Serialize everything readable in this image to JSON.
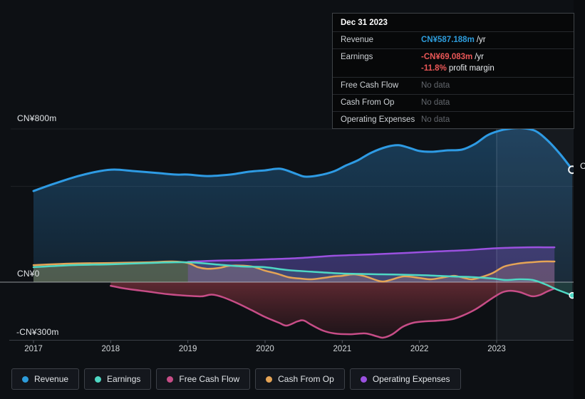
{
  "y_axis": {
    "top_label": "CN¥800m",
    "zero_label": "CN¥0",
    "bottom_label": "-CN¥300m"
  },
  "x_axis": {
    "years": [
      "2017",
      "2018",
      "2019",
      "2020",
      "2021",
      "2022",
      "2023"
    ]
  },
  "edge_label": "C",
  "tooltip": {
    "date": "Dec 31 2023",
    "rows": [
      {
        "label": "Revenue",
        "value": "CN¥587.188m",
        "suffix": "/yr"
      },
      {
        "label": "Earnings",
        "value": "-CN¥69.083m",
        "suffix": "/yr",
        "extra_value": "-11.8%",
        "extra_suffix": "profit margin"
      },
      {
        "label": "Free Cash Flow",
        "value": "No data"
      },
      {
        "label": "Cash From Op",
        "value": "No data"
      },
      {
        "label": "Operating Expenses",
        "value": "No data"
      }
    ]
  },
  "legend": [
    {
      "label": "Revenue",
      "color": "#2d9cdb"
    },
    {
      "label": "Earnings",
      "color": "#4fd8c4"
    },
    {
      "label": "Free Cash Flow",
      "color": "#c74d87"
    },
    {
      "label": "Cash From Op",
      "color": "#e5a456"
    },
    {
      "label": "Operating Expenses",
      "color": "#9b51e0"
    }
  ],
  "chart_data": {
    "type": "line",
    "title": "Earnings and Revenue History",
    "unit": "CN¥ millions",
    "x_range": [
      2017,
      2024
    ],
    "x_ticks": [
      2017,
      2018,
      2019,
      2020,
      2021,
      2022,
      2023
    ],
    "y_gridlines_labeled": [
      800,
      0,
      -300
    ],
    "highlight_from_x": 2023,
    "legend_position": "bottom",
    "series": [
      {
        "name": "Revenue",
        "color": "#2e9be4",
        "end_marker": "open-circle",
        "last_value_label": "CN¥587.188m /yr",
        "points": [
          [
            2017.0,
            476
          ],
          [
            2017.26,
            513
          ],
          [
            2017.58,
            554
          ],
          [
            2017.86,
            580
          ],
          [
            2018.05,
            588
          ],
          [
            2018.3,
            580
          ],
          [
            2018.6,
            570
          ],
          [
            2018.85,
            562
          ],
          [
            2019.0,
            562
          ],
          [
            2019.25,
            554
          ],
          [
            2019.55,
            562
          ],
          [
            2019.8,
            577
          ],
          [
            2020.0,
            584
          ],
          [
            2020.2,
            592
          ],
          [
            2020.4,
            566
          ],
          [
            2020.52,
            551
          ],
          [
            2020.7,
            558
          ],
          [
            2020.9,
            580
          ],
          [
            2021.05,
            610
          ],
          [
            2021.2,
            636
          ],
          [
            2021.38,
            677
          ],
          [
            2021.58,
            707
          ],
          [
            2021.73,
            715
          ],
          [
            2021.88,
            700
          ],
          [
            2022.0,
            685
          ],
          [
            2022.17,
            681
          ],
          [
            2022.35,
            688
          ],
          [
            2022.55,
            692
          ],
          [
            2022.72,
            722
          ],
          [
            2022.88,
            767
          ],
          [
            2023.03,
            790
          ],
          [
            2023.18,
            802
          ],
          [
            2023.33,
            805
          ],
          [
            2023.5,
            790
          ],
          [
            2023.65,
            744
          ],
          [
            2023.82,
            670
          ],
          [
            2023.98,
            587.188
          ]
        ]
      },
      {
        "name": "Free Cash Flow",
        "color": "#c74d87",
        "points": [
          [
            2018.0,
            -19
          ],
          [
            2018.18,
            -33
          ],
          [
            2018.46,
            -48
          ],
          [
            2018.74,
            -63
          ],
          [
            2019.0,
            -71
          ],
          [
            2019.18,
            -74
          ],
          [
            2019.31,
            -65
          ],
          [
            2019.45,
            -78
          ],
          [
            2019.63,
            -108
          ],
          [
            2019.82,
            -145
          ],
          [
            2020.0,
            -182
          ],
          [
            2020.18,
            -212
          ],
          [
            2020.28,
            -227
          ],
          [
            2020.42,
            -205
          ],
          [
            2020.5,
            -200
          ],
          [
            2020.6,
            -223
          ],
          [
            2020.75,
            -253
          ],
          [
            2020.9,
            -268
          ],
          [
            2021.1,
            -272
          ],
          [
            2021.3,
            -268
          ],
          [
            2021.45,
            -283
          ],
          [
            2021.53,
            -290
          ],
          [
            2021.65,
            -272
          ],
          [
            2021.78,
            -234
          ],
          [
            2021.92,
            -212
          ],
          [
            2022.06,
            -205
          ],
          [
            2022.25,
            -201
          ],
          [
            2022.43,
            -193
          ],
          [
            2022.58,
            -171
          ],
          [
            2022.73,
            -141
          ],
          [
            2022.87,
            -104
          ],
          [
            2022.98,
            -74
          ],
          [
            2023.08,
            -52
          ],
          [
            2023.18,
            -45
          ],
          [
            2023.3,
            -52
          ],
          [
            2023.4,
            -67
          ],
          [
            2023.47,
            -74
          ],
          [
            2023.56,
            -67
          ],
          [
            2023.66,
            -48
          ],
          [
            2023.75,
            -33
          ]
        ]
      },
      {
        "name": "Operating Expenses",
        "color": "#9b51e0",
        "points": [
          [
            2019.0,
            106
          ],
          [
            2019.35,
            112
          ],
          [
            2019.7,
            115
          ],
          [
            2020.0,
            119
          ],
          [
            2020.45,
            126
          ],
          [
            2020.9,
            138
          ],
          [
            2021.4,
            145
          ],
          [
            2021.85,
            153
          ],
          [
            2022.2,
            160
          ],
          [
            2022.6,
            167
          ],
          [
            2022.9,
            175
          ],
          [
            2023.12,
            179
          ],
          [
            2023.4,
            182
          ],
          [
            2023.75,
            182
          ]
        ]
      },
      {
        "name": "Cash From Op",
        "color": "#e5a456",
        "points": [
          [
            2017.0,
            89
          ],
          [
            2017.5,
            97
          ],
          [
            2018.0,
            100
          ],
          [
            2018.5,
            104
          ],
          [
            2018.8,
            108
          ],
          [
            2019.0,
            100
          ],
          [
            2019.13,
            78
          ],
          [
            2019.25,
            70
          ],
          [
            2019.4,
            74
          ],
          [
            2019.55,
            86
          ],
          [
            2019.72,
            86
          ],
          [
            2019.85,
            80
          ],
          [
            2020.0,
            60
          ],
          [
            2020.15,
            45
          ],
          [
            2020.3,
            26
          ],
          [
            2020.45,
            19
          ],
          [
            2020.6,
            15
          ],
          [
            2020.75,
            22
          ],
          [
            2020.9,
            30
          ],
          [
            2021.0,
            33
          ],
          [
            2021.15,
            41
          ],
          [
            2021.3,
            30
          ],
          [
            2021.5,
            4
          ],
          [
            2021.62,
            11
          ],
          [
            2021.8,
            30
          ],
          [
            2022.0,
            22
          ],
          [
            2022.15,
            15
          ],
          [
            2022.33,
            26
          ],
          [
            2022.45,
            33
          ],
          [
            2022.58,
            22
          ],
          [
            2022.68,
            15
          ],
          [
            2022.8,
            26
          ],
          [
            2022.95,
            48
          ],
          [
            2023.1,
            82
          ],
          [
            2023.28,
            97
          ],
          [
            2023.45,
            104
          ],
          [
            2023.6,
            108
          ],
          [
            2023.75,
            108
          ]
        ]
      },
      {
        "name": "Earnings",
        "color": "#4fd8c4",
        "end_marker": "dot",
        "last_value_label": "-CN¥69.083m /yr",
        "points": [
          [
            2017.0,
            78
          ],
          [
            2017.5,
            89
          ],
          [
            2018.0,
            93
          ],
          [
            2018.5,
            100
          ],
          [
            2019.0,
            104
          ],
          [
            2019.35,
            93
          ],
          [
            2019.7,
            82
          ],
          [
            2020.0,
            78
          ],
          [
            2020.3,
            63
          ],
          [
            2020.7,
            52
          ],
          [
            2021.0,
            45
          ],
          [
            2021.5,
            41
          ],
          [
            2022.0,
            37
          ],
          [
            2022.4,
            30
          ],
          [
            2022.7,
            26
          ],
          [
            2022.95,
            19
          ],
          [
            2023.12,
            11
          ],
          [
            2023.3,
            15
          ],
          [
            2023.47,
            11
          ],
          [
            2023.63,
            -11
          ],
          [
            2023.77,
            -37
          ],
          [
            2023.98,
            -69.083
          ]
        ]
      }
    ]
  }
}
